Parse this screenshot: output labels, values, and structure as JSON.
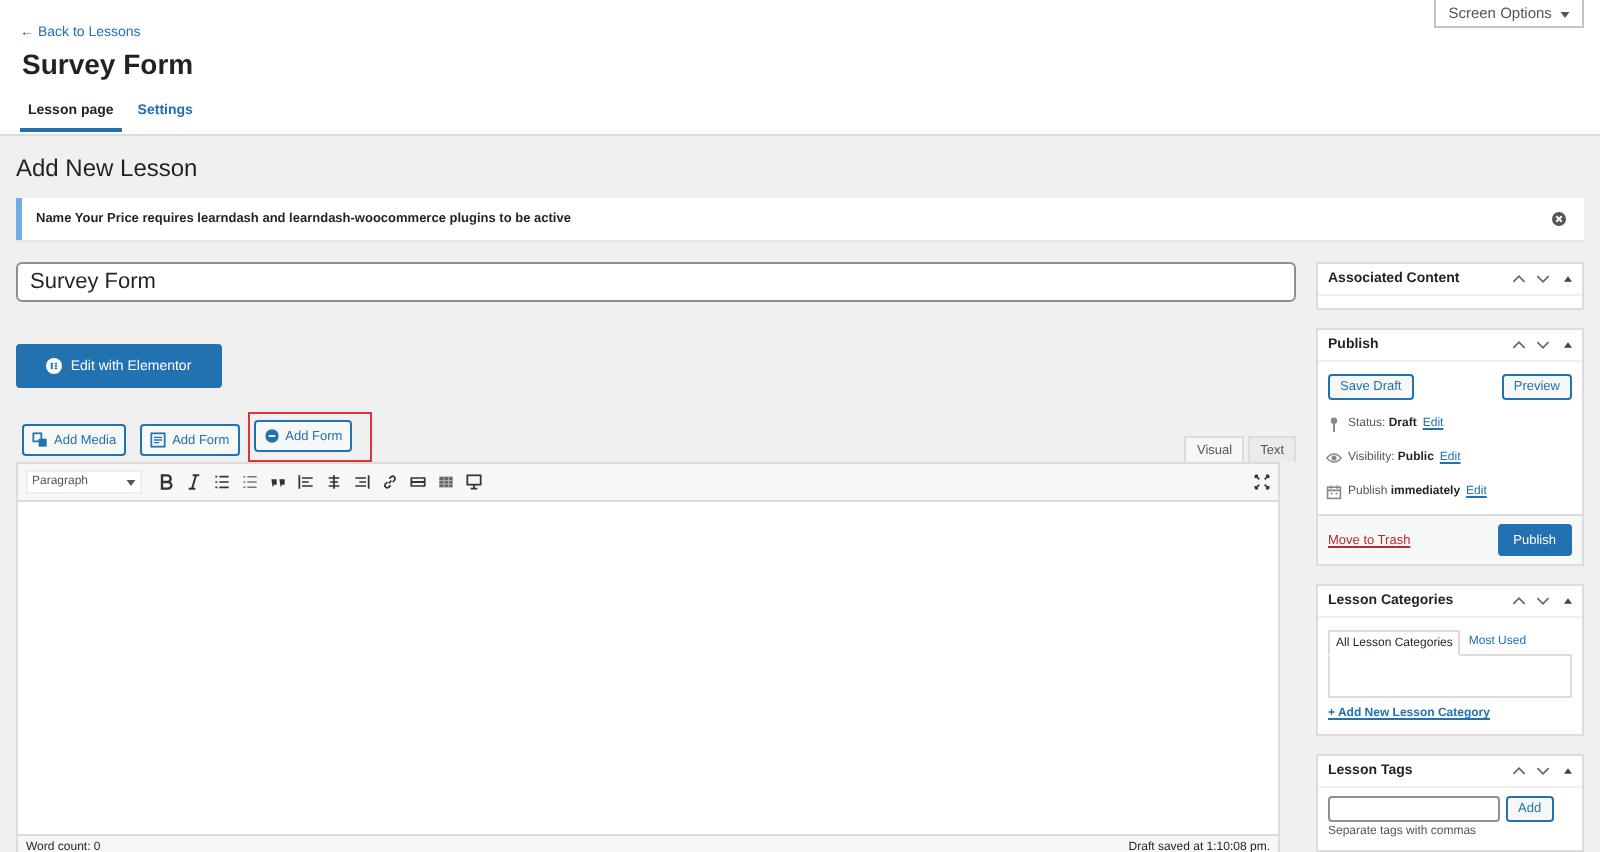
{
  "screen_options": "Screen Options",
  "back_link": "← Back to Lessons",
  "title": "Survey Form",
  "tabs": [
    {
      "label": "Lesson page",
      "selected": true
    },
    {
      "label": "Settings",
      "selected": false
    }
  ],
  "heading": "Add New Lesson",
  "notice": {
    "text": "Name Your Price requires learndash and learndash-woocommerce plugins to be active"
  },
  "post_title": "Survey Form",
  "elementor_button": "Edit with Elementor",
  "media_buttons": [
    {
      "label": "Add Media",
      "kind": "media",
      "highlighted": false
    },
    {
      "label": "Add Form",
      "kind": "form",
      "highlighted": false
    },
    {
      "label": "Add Form",
      "kind": "circle",
      "highlighted": true
    }
  ],
  "editor_tabs": [
    {
      "label": "Visual",
      "selected": true
    },
    {
      "label": "Text",
      "selected": false
    }
  ],
  "format_select": "Paragraph",
  "word_count": "Word count: 0",
  "draft_saved": "Draft saved at 1:10:08 pm.",
  "sidebar": {
    "associated": {
      "title": "Associated Content"
    },
    "publish": {
      "title": "Publish",
      "save_draft": "Save Draft",
      "preview": "Preview",
      "rows": [
        {
          "kind": "status",
          "label": "Status:",
          "value": "Draft",
          "link": "Edit"
        },
        {
          "kind": "visibility",
          "label": "Visibility:",
          "value": "Public",
          "link": "Edit"
        },
        {
          "kind": "schedule",
          "label": "Publish",
          "value": "immediately",
          "link": "Edit"
        }
      ],
      "trash": "Move to Trash",
      "publish_button": "Publish"
    },
    "categories": {
      "title": "Lesson Categories",
      "tabs": [
        {
          "label": "All Lesson Categories",
          "selected": true
        },
        {
          "label": "Most Used",
          "selected": false
        }
      ],
      "add_link": "+ Add New Lesson Category"
    },
    "tags": {
      "title": "Lesson Tags",
      "add_button": "Add",
      "hint": "Separate tags with commas"
    }
  }
}
